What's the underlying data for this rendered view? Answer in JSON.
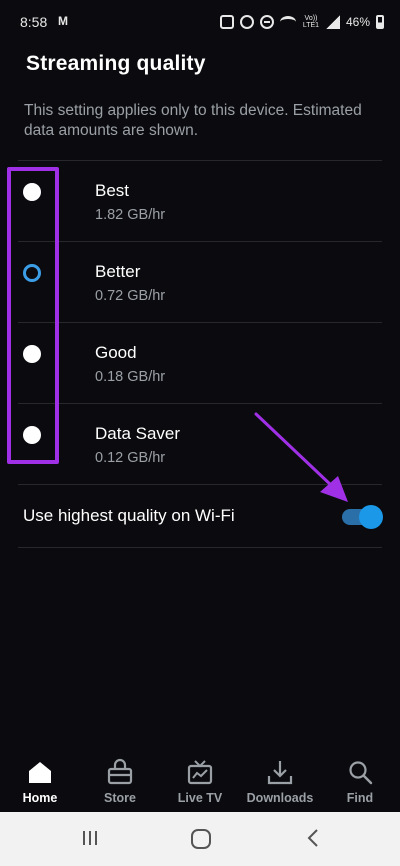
{
  "status_bar": {
    "time": "8:58",
    "mail_badge": "M",
    "network": "Vo)) LTE1",
    "battery": "46%"
  },
  "header": {
    "title": "Streaming quality",
    "description": "This setting applies only to this device. Estimated data amounts are shown."
  },
  "options": [
    {
      "label": "Best",
      "rate": "1.82 GB/hr",
      "selected": false
    },
    {
      "label": "Better",
      "rate": "0.72 GB/hr",
      "selected": true
    },
    {
      "label": "Good",
      "rate": "0.18 GB/hr",
      "selected": false
    },
    {
      "label": "Data Saver",
      "rate": "0.12 GB/hr",
      "selected": false
    }
  ],
  "wifi_setting": {
    "label": "Use highest quality on Wi-Fi",
    "enabled": true
  },
  "bottom_nav": [
    {
      "label": "Home",
      "icon": "home-icon",
      "active": true
    },
    {
      "label": "Store",
      "icon": "store-bag-icon",
      "active": false
    },
    {
      "label": "Live TV",
      "icon": "live-tv-icon",
      "active": false
    },
    {
      "label": "Downloads",
      "icon": "download-icon",
      "active": false
    },
    {
      "label": "Find",
      "icon": "search-icon",
      "active": false
    }
  ],
  "colors": {
    "background": "#0b0b0f",
    "accent": "#1c98e8",
    "annotation": "#a030e6",
    "secondary_text": "#9aa0a6"
  }
}
